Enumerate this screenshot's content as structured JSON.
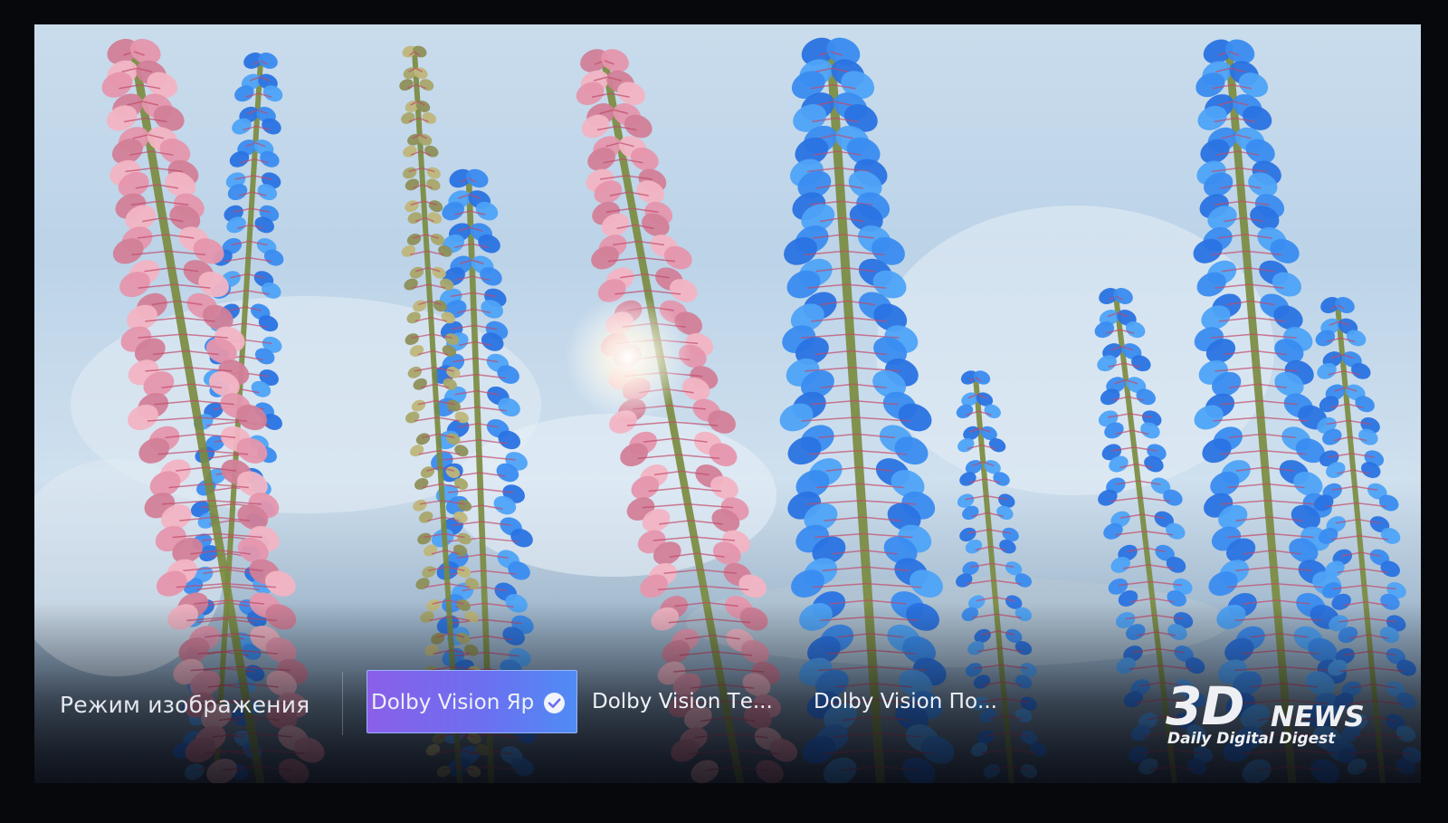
{
  "menu": {
    "title": "Режим изображения",
    "options": [
      {
        "label": "Dolby Vision Яр",
        "selected": true
      },
      {
        "label": "Dolby Vision Те...",
        "selected": false
      },
      {
        "label": "Dolby Vision По...",
        "selected": false
      }
    ]
  },
  "watermark": {
    "brand_3d": "3D",
    "brand_news": "NEWS",
    "tagline": "Daily Digital Digest"
  },
  "colors": {
    "selected_start": "#8a5fe9",
    "selected_end": "#4f8cf5",
    "pink_flower": "#e8a3b6",
    "blue_flower": "#3f8cf0"
  },
  "icons": {
    "selected_indicator": "check-circle-icon"
  }
}
